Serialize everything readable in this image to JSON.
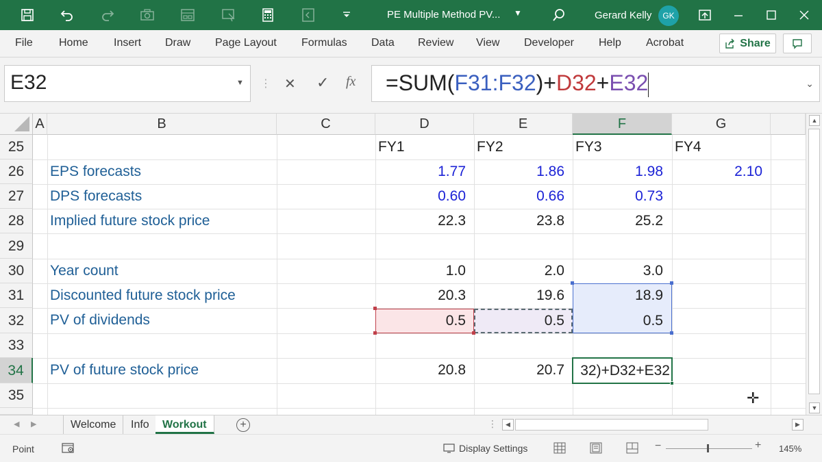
{
  "window": {
    "title": "PE Multiple Method PV...",
    "user_name": "Gerard Kelly",
    "user_initials": "GK",
    "accent_color": "#217346"
  },
  "ribbon": {
    "tabs": [
      "File",
      "Home",
      "Insert",
      "Draw",
      "Page Layout",
      "Formulas",
      "Data",
      "Review",
      "View",
      "Developer",
      "Help",
      "Acrobat"
    ],
    "share_label": "Share"
  },
  "formula_bar": {
    "name_box": "E32",
    "formula_parts": [
      {
        "text": "=SUM(",
        "color": "#222222"
      },
      {
        "text": "F31:F32",
        "color": "#3a5fbf"
      },
      {
        "text": ")+",
        "color": "#222222"
      },
      {
        "text": "D32",
        "color": "#c0393b"
      },
      {
        "text": "+",
        "color": "#222222"
      },
      {
        "text": "E32",
        "color": "#7a4fb0"
      }
    ],
    "fx_label": "fx"
  },
  "grid": {
    "columns": [
      "A",
      "B",
      "C",
      "D",
      "E",
      "F",
      "G"
    ],
    "selected_column": "F",
    "rows": [
      "25",
      "26",
      "27",
      "28",
      "29",
      "30",
      "31",
      "32",
      "33",
      "34",
      "35"
    ],
    "selected_row": "34",
    "labels": {
      "r26": "EPS forecasts",
      "r27": "DPS forecasts",
      "r28": "Implied future stock price",
      "r30": "Year count",
      "r31": "Discounted future stock price",
      "r32": "PV of dividends",
      "r34": "PV of future stock price"
    },
    "fiscal_years": [
      "FY1",
      "FY2",
      "FY3",
      "FY4"
    ],
    "eps": [
      "1.77",
      "1.86",
      "1.98",
      "2.10"
    ],
    "dps": [
      "0.60",
      "0.66",
      "0.73"
    ],
    "implied_price": [
      "22.3",
      "23.8",
      "25.2"
    ],
    "year_count": [
      "1.0",
      "2.0",
      "3.0"
    ],
    "discounted_price": [
      "20.3",
      "19.6",
      "18.9"
    ],
    "pv_dividends": [
      "0.5",
      "0.5",
      "0.5"
    ],
    "pv_future_price": [
      "20.8",
      "20.7"
    ],
    "active_cell_text": "32)+D32+E32"
  },
  "sheets": {
    "tabs": [
      "Welcome",
      "Info",
      "Workout"
    ],
    "active": "Workout"
  },
  "status": {
    "mode": "Point",
    "display_settings": "Display Settings",
    "zoom": "145%"
  }
}
